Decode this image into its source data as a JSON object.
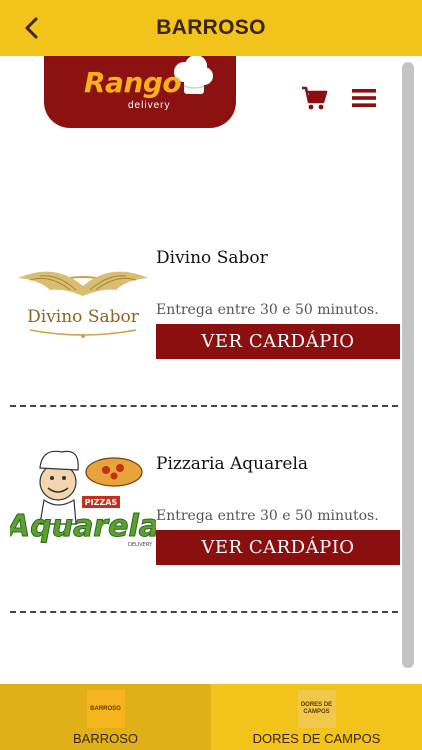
{
  "header": {
    "title": "BARROSO"
  },
  "brand": {
    "logo_text": "Rango",
    "logo_sub": "delivery"
  },
  "restaurants": [
    {
      "name": "Divino Sabor",
      "logo_text": "Divino Sabor",
      "delivery": "Entrega entre 30 e 50 minutos.",
      "button": "VER CARDÁPIO"
    },
    {
      "name": "Pizzaria Aquarela",
      "logo_text": "Aquarela",
      "logo_badge": "PIZZAS",
      "logo_small": "DELIVERY",
      "delivery": "Entrega entre 30 e 50 minutos.",
      "button": "VER CARDÁPIO"
    }
  ],
  "tabs": [
    {
      "thumb": "BARROSO",
      "label": "BARROSO"
    },
    {
      "thumb": "DORES DE CAMPOS",
      "label": "DORES DE CAMPOS"
    }
  ],
  "icons": {
    "back": "chevron-left-icon",
    "cart": "cart-icon",
    "menu": "hamburger-menu-icon"
  },
  "colors": {
    "header": "#f2c31a",
    "brand_red": "#8c0f0f",
    "brand_gold": "#f7b21b"
  }
}
